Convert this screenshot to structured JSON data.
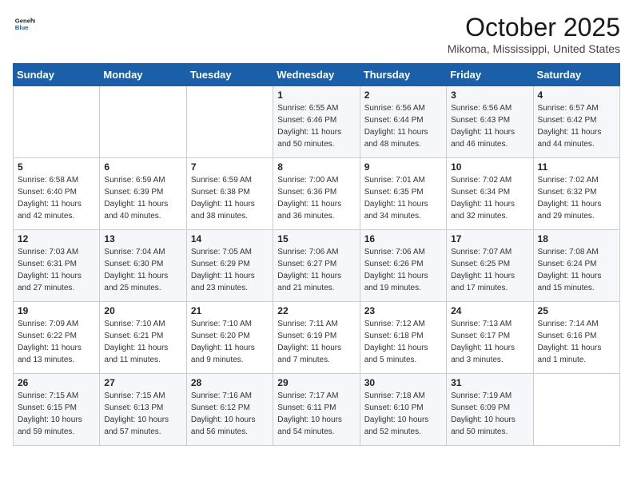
{
  "header": {
    "logo_general": "General",
    "logo_blue": "Blue",
    "month_year": "October 2025",
    "location": "Mikoma, Mississippi, United States"
  },
  "weekdays": [
    "Sunday",
    "Monday",
    "Tuesday",
    "Wednesday",
    "Thursday",
    "Friday",
    "Saturday"
  ],
  "weeks": [
    [
      {
        "day": "",
        "info": ""
      },
      {
        "day": "",
        "info": ""
      },
      {
        "day": "",
        "info": ""
      },
      {
        "day": "1",
        "info": "Sunrise: 6:55 AM\nSunset: 6:46 PM\nDaylight: 11 hours\nand 50 minutes."
      },
      {
        "day": "2",
        "info": "Sunrise: 6:56 AM\nSunset: 6:44 PM\nDaylight: 11 hours\nand 48 minutes."
      },
      {
        "day": "3",
        "info": "Sunrise: 6:56 AM\nSunset: 6:43 PM\nDaylight: 11 hours\nand 46 minutes."
      },
      {
        "day": "4",
        "info": "Sunrise: 6:57 AM\nSunset: 6:42 PM\nDaylight: 11 hours\nand 44 minutes."
      }
    ],
    [
      {
        "day": "5",
        "info": "Sunrise: 6:58 AM\nSunset: 6:40 PM\nDaylight: 11 hours\nand 42 minutes."
      },
      {
        "day": "6",
        "info": "Sunrise: 6:59 AM\nSunset: 6:39 PM\nDaylight: 11 hours\nand 40 minutes."
      },
      {
        "day": "7",
        "info": "Sunrise: 6:59 AM\nSunset: 6:38 PM\nDaylight: 11 hours\nand 38 minutes."
      },
      {
        "day": "8",
        "info": "Sunrise: 7:00 AM\nSunset: 6:36 PM\nDaylight: 11 hours\nand 36 minutes."
      },
      {
        "day": "9",
        "info": "Sunrise: 7:01 AM\nSunset: 6:35 PM\nDaylight: 11 hours\nand 34 minutes."
      },
      {
        "day": "10",
        "info": "Sunrise: 7:02 AM\nSunset: 6:34 PM\nDaylight: 11 hours\nand 32 minutes."
      },
      {
        "day": "11",
        "info": "Sunrise: 7:02 AM\nSunset: 6:32 PM\nDaylight: 11 hours\nand 29 minutes."
      }
    ],
    [
      {
        "day": "12",
        "info": "Sunrise: 7:03 AM\nSunset: 6:31 PM\nDaylight: 11 hours\nand 27 minutes."
      },
      {
        "day": "13",
        "info": "Sunrise: 7:04 AM\nSunset: 6:30 PM\nDaylight: 11 hours\nand 25 minutes."
      },
      {
        "day": "14",
        "info": "Sunrise: 7:05 AM\nSunset: 6:29 PM\nDaylight: 11 hours\nand 23 minutes."
      },
      {
        "day": "15",
        "info": "Sunrise: 7:06 AM\nSunset: 6:27 PM\nDaylight: 11 hours\nand 21 minutes."
      },
      {
        "day": "16",
        "info": "Sunrise: 7:06 AM\nSunset: 6:26 PM\nDaylight: 11 hours\nand 19 minutes."
      },
      {
        "day": "17",
        "info": "Sunrise: 7:07 AM\nSunset: 6:25 PM\nDaylight: 11 hours\nand 17 minutes."
      },
      {
        "day": "18",
        "info": "Sunrise: 7:08 AM\nSunset: 6:24 PM\nDaylight: 11 hours\nand 15 minutes."
      }
    ],
    [
      {
        "day": "19",
        "info": "Sunrise: 7:09 AM\nSunset: 6:22 PM\nDaylight: 11 hours\nand 13 minutes."
      },
      {
        "day": "20",
        "info": "Sunrise: 7:10 AM\nSunset: 6:21 PM\nDaylight: 11 hours\nand 11 minutes."
      },
      {
        "day": "21",
        "info": "Sunrise: 7:10 AM\nSunset: 6:20 PM\nDaylight: 11 hours\nand 9 minutes."
      },
      {
        "day": "22",
        "info": "Sunrise: 7:11 AM\nSunset: 6:19 PM\nDaylight: 11 hours\nand 7 minutes."
      },
      {
        "day": "23",
        "info": "Sunrise: 7:12 AM\nSunset: 6:18 PM\nDaylight: 11 hours\nand 5 minutes."
      },
      {
        "day": "24",
        "info": "Sunrise: 7:13 AM\nSunset: 6:17 PM\nDaylight: 11 hours\nand 3 minutes."
      },
      {
        "day": "25",
        "info": "Sunrise: 7:14 AM\nSunset: 6:16 PM\nDaylight: 11 hours\nand 1 minute."
      }
    ],
    [
      {
        "day": "26",
        "info": "Sunrise: 7:15 AM\nSunset: 6:15 PM\nDaylight: 10 hours\nand 59 minutes."
      },
      {
        "day": "27",
        "info": "Sunrise: 7:15 AM\nSunset: 6:13 PM\nDaylight: 10 hours\nand 57 minutes."
      },
      {
        "day": "28",
        "info": "Sunrise: 7:16 AM\nSunset: 6:12 PM\nDaylight: 10 hours\nand 56 minutes."
      },
      {
        "day": "29",
        "info": "Sunrise: 7:17 AM\nSunset: 6:11 PM\nDaylight: 10 hours\nand 54 minutes."
      },
      {
        "day": "30",
        "info": "Sunrise: 7:18 AM\nSunset: 6:10 PM\nDaylight: 10 hours\nand 52 minutes."
      },
      {
        "day": "31",
        "info": "Sunrise: 7:19 AM\nSunset: 6:09 PM\nDaylight: 10 hours\nand 50 minutes."
      },
      {
        "day": "",
        "info": ""
      }
    ]
  ]
}
